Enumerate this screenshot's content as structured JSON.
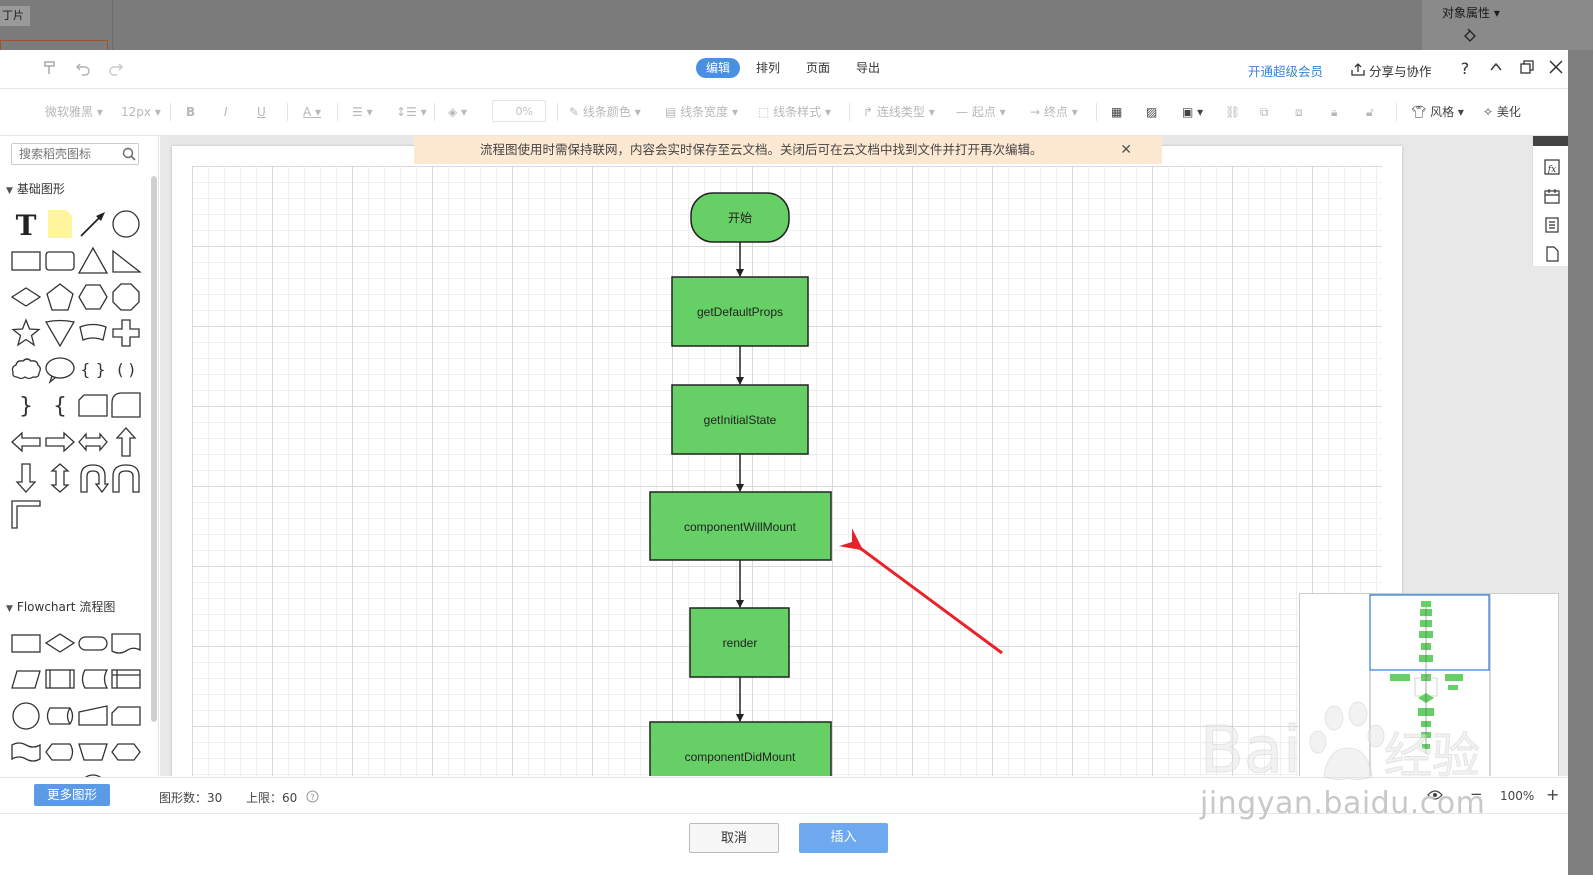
{
  "host": {
    "tab_label": "丁片",
    "right_panel_label": "对象属性 ▾"
  },
  "top": {
    "tabs": [
      {
        "label": "编辑",
        "active": true
      },
      {
        "label": "排列",
        "active": false
      },
      {
        "label": "页面",
        "active": false
      },
      {
        "label": "导出",
        "active": false
      }
    ],
    "vip_link": "开通超级会员",
    "share_label": "分享与协作",
    "help_icon": "?"
  },
  "toolbar": {
    "font_name": "微软雅黑",
    "font_size": "12px",
    "bold": "B",
    "italic": "I",
    "underline": "U",
    "font_color": "A",
    "opacity_value": "0%",
    "line_color": "线条颜色",
    "line_width": "线条宽度",
    "line_style": "线条样式",
    "connector_type": "连线类型",
    "start_point": "起点",
    "end_point": "终点",
    "style": "风格",
    "beautify": "美化"
  },
  "sidebar": {
    "search_placeholder": "搜索稻壳图标",
    "section_basic": "基础图形",
    "section_flowchart": "Flowchart 流程图",
    "more_shapes": "更多图形"
  },
  "notice": {
    "text": "流程图使用时需保持联网，内容会实时保存至云文档。关闭后可在云文档中找到文件并打开再次编辑。"
  },
  "flowchart": {
    "nodes": [
      "开始",
      "getDefaultProps",
      "getInitialState",
      "componentWillMount",
      "render",
      "componentDidMount"
    ]
  },
  "status": {
    "shape_count": "图形数：30",
    "limit": "上限：60",
    "zoom": "100%",
    "zoom_out": "−",
    "zoom_in": "+"
  },
  "footer": {
    "cancel": "取消",
    "insert": "插入"
  },
  "watermark": {
    "url": "jingyan.baidu.com"
  },
  "colors": {
    "node_fill": "#66d066",
    "accent_blue": "#4a90e2",
    "arrow_red": "#e8212b"
  }
}
